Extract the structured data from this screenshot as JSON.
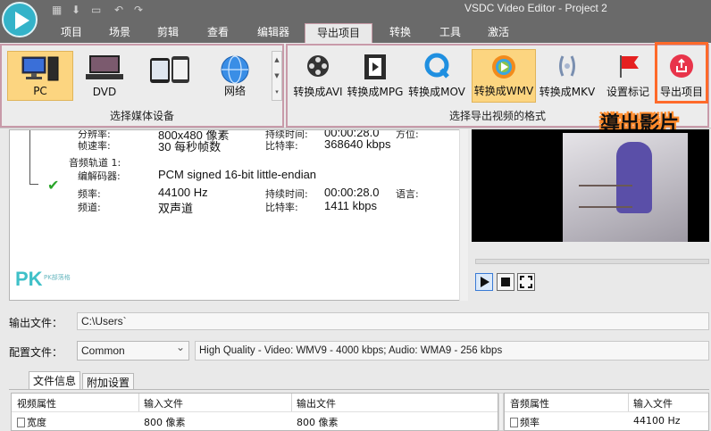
{
  "window": {
    "title": "VSDC Video Editor - Project 2",
    "quick_access": [
      "▦",
      "⬇",
      "▭",
      "↶",
      "↷"
    ]
  },
  "menu": [
    "项目",
    "场景",
    "剪辑",
    "查看",
    "编辑器",
    "导出项目",
    "转换",
    "工具",
    "激活"
  ],
  "active_menu": "导出项目",
  "ribbon": {
    "devices": [
      {
        "label": "PC",
        "icon": "desktop-pc-icon",
        "selected": true
      },
      {
        "label": "DVD",
        "icon": "dvd-player-icon",
        "selected": false
      },
      {
        "label": "",
        "icon": "mobile-devices-icon",
        "selected": false
      },
      {
        "label": "网络",
        "icon": "web-globe-icon",
        "selected": false
      }
    ],
    "device_group_label": "选择媒体设备",
    "formats": [
      {
        "label": "转换成AVI",
        "icon": "film-reel-icon",
        "selected": false
      },
      {
        "label": "转换成MPG",
        "icon": "film-strip-icon",
        "selected": false
      },
      {
        "label": "转换成MOV",
        "icon": "quicktime-icon",
        "selected": false
      },
      {
        "label": "转换成WMV",
        "icon": "windows-media-icon",
        "selected": true
      },
      {
        "label": "转换成MKV",
        "icon": "matroska-icon",
        "selected": false
      },
      {
        "label": "设置标记",
        "icon": "red-flag-icon",
        "selected": false
      },
      {
        "label": "导出项目",
        "icon": "export-icon",
        "selected": false
      }
    ],
    "format_group_label": "选择导出视频的格式"
  },
  "annotation": {
    "callout": "導出影片"
  },
  "info": {
    "video_rows": [
      {
        "k1": "分辨率:",
        "v1": "800x480 像素",
        "k2": "持续时间:",
        "v2": "00:00:28.0",
        "k3": "方位:"
      },
      {
        "k1": "帧速率:",
        "v1": "30 每秒帧数",
        "k2": "比特率:",
        "v2": "368640 kbps",
        "k3": ""
      }
    ],
    "audio_title": "音频轨道 1:",
    "audio_codec_label": "编解码器:",
    "audio_codec_value": "PCM signed 16-bit little-endian",
    "audio_rows": [
      {
        "k1": "频率:",
        "v1": "44100 Hz",
        "k2": "持续时间:",
        "v2": "00:00:28.0",
        "k3": "语言:"
      },
      {
        "k1": "频道:",
        "v1": "双声道",
        "k2": "比特率:",
        "v2": "1411 kbps",
        "k3": ""
      }
    ],
    "watermark": "PK",
    "watermark_sub": "PK部落格"
  },
  "output": {
    "file_label": "输出文件：",
    "file_value": "C:\\Users`",
    "profile_label": "配置文件：",
    "profile_value": "Common",
    "profile_desc": "High Quality - Video: WMV9 - 4000 kbps; Audio: WMA9 - 256 kbps"
  },
  "tabs": [
    "文件信息",
    "附加设置"
  ],
  "video_table": {
    "headers": [
      "视频属性",
      "输入文件",
      "输出文件"
    ],
    "row": [
      "宽度",
      "800 像素",
      "800 像素"
    ]
  },
  "audio_table": {
    "headers": [
      "音频属性",
      "输入文件"
    ],
    "row": [
      "频率",
      "44100 Hz"
    ]
  },
  "colors": {
    "accent": "#fcd580",
    "highlight": "#ff6a2a",
    "ribbon_border": "#c89aa9"
  }
}
